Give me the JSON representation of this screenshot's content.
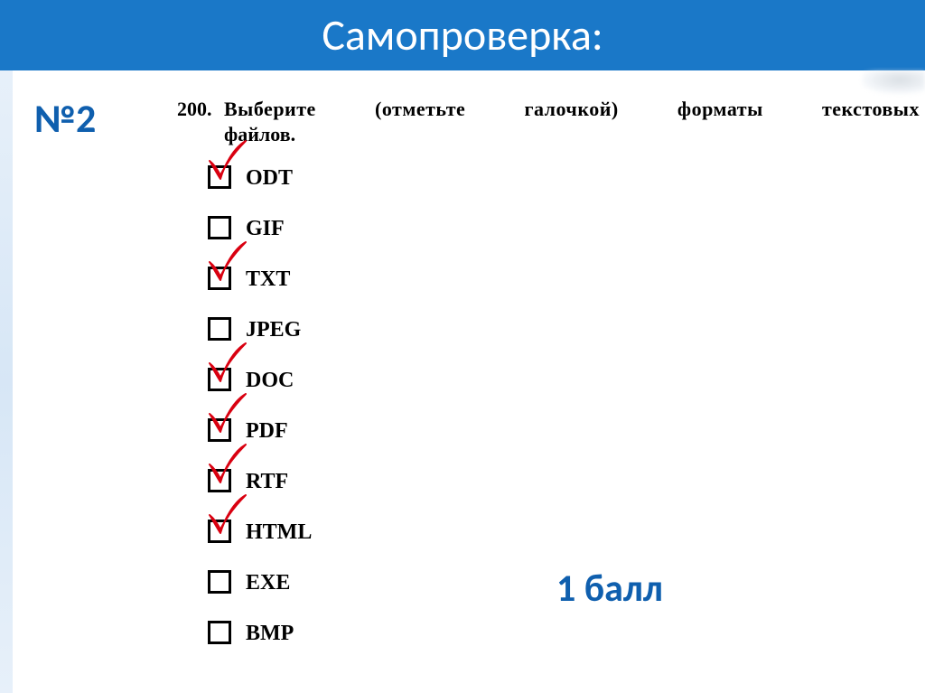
{
  "header": {
    "title": "Самопроверка:"
  },
  "task": {
    "label": "№2"
  },
  "question": {
    "number": "200.",
    "words": [
      "Выберите",
      "(отметьте",
      "галочкой)",
      "форматы",
      "текстовых"
    ],
    "second_line": "файлов."
  },
  "options": [
    {
      "label": "ODT",
      "checked": true
    },
    {
      "label": "GIF",
      "checked": false
    },
    {
      "label": "TXT",
      "checked": true
    },
    {
      "label": "JPEG",
      "checked": false
    },
    {
      "label": "DOC",
      "checked": true
    },
    {
      "label": "PDF",
      "checked": true
    },
    {
      "label": "RTF",
      "checked": true
    },
    {
      "label": "HTML",
      "checked": true
    },
    {
      "label": "EXE",
      "checked": false
    },
    {
      "label": "BMP",
      "checked": false
    }
  ],
  "score": {
    "text": "1 балл"
  },
  "tick_color": "#d90010"
}
